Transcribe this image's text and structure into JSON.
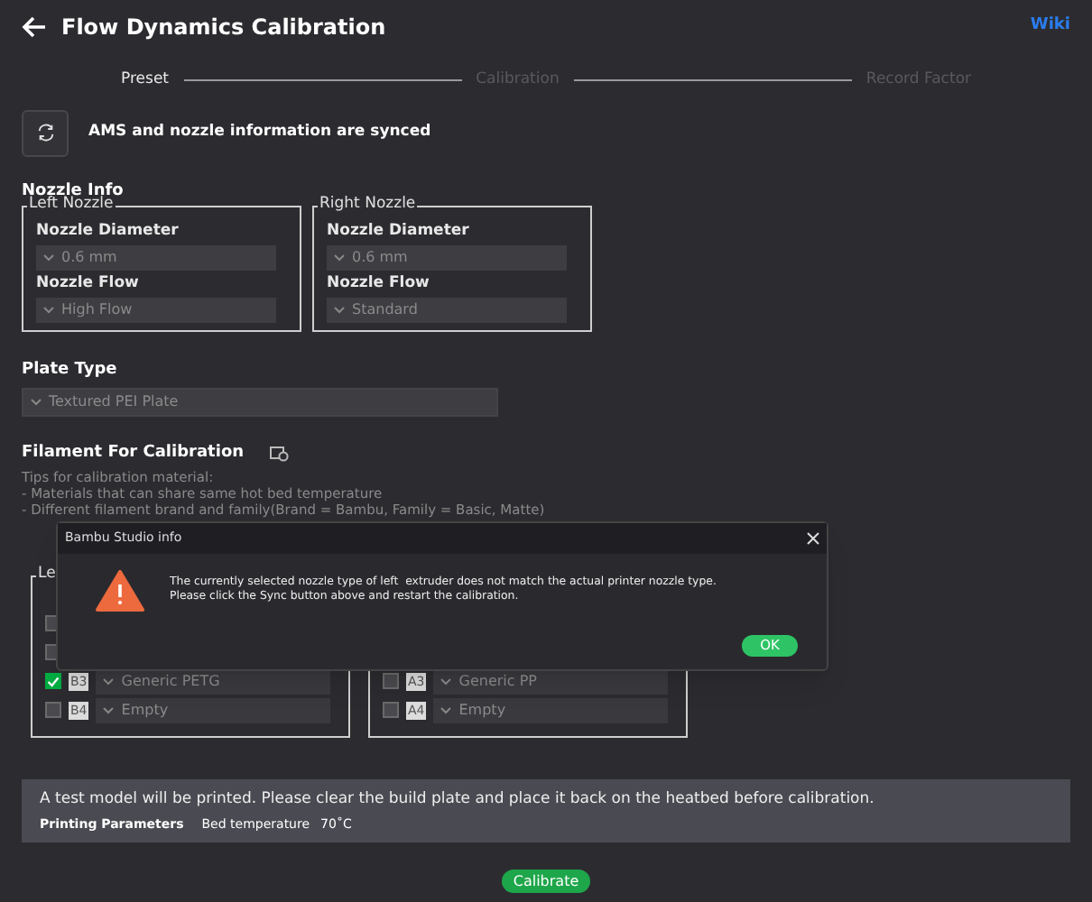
{
  "header": {
    "title": "Flow Dynamics Calibration",
    "wiki": "Wiki"
  },
  "steps": [
    {
      "label": "Preset",
      "selected": true
    },
    {
      "label": "Calibration",
      "selected": false
    },
    {
      "label": "Record Factor",
      "selected": false
    }
  ],
  "sync": {
    "message": "AMS and nozzle information are synced"
  },
  "nozzle_info": {
    "title": "Nozzle Info",
    "nozzles": [
      {
        "legend": "Left Nozzle",
        "diameter_label": "Nozzle Diameter",
        "diameter": "0.6 mm",
        "flow_label": "Nozzle Flow",
        "flow": "High Flow"
      },
      {
        "legend": "Right Nozzle",
        "diameter_label": "Nozzle Diameter",
        "diameter": "0.6 mm",
        "flow_label": "Nozzle Flow",
        "flow": "Standard"
      }
    ]
  },
  "plate": {
    "title": "Plate Type",
    "value": "Textured PEI Plate"
  },
  "filament": {
    "title": "Filament For Calibration",
    "tips": [
      "Tips for calibration material:",
      "- Materials that can share same hot bed temperature",
      "- Different filament brand and family(Brand = Bambu, Family = Basic, Matte)"
    ],
    "groups": [
      {
        "legend": "Le",
        "rows": [
          {
            "checked": false
          },
          {
            "checked": false
          },
          {
            "checked": true,
            "slot": "B3",
            "value": "Generic PETG"
          },
          {
            "checked": false,
            "slot": "B4",
            "value": "Empty"
          }
        ]
      },
      {
        "rows": [
          {
            "checked": false,
            "slot": "A3",
            "value": "Generic PP"
          },
          {
            "checked": false,
            "slot": "A4",
            "value": "Empty"
          }
        ]
      }
    ]
  },
  "notice": {
    "text": "A test model will be printed. Please clear the build plate and place it back on the heatbed before calibration.",
    "params_label": "Printing Parameters",
    "param_name": "Bed temperature",
    "param_value": "70˚C"
  },
  "calibrate_button": "Calibrate",
  "dialog": {
    "title": "Bambu Studio info",
    "lines": [
      "The currently selected nozzle type of left  extruder does not match the actual printer nozzle type.",
      "Please click the Sync button above and restart the calibration."
    ],
    "ok": "OK"
  }
}
